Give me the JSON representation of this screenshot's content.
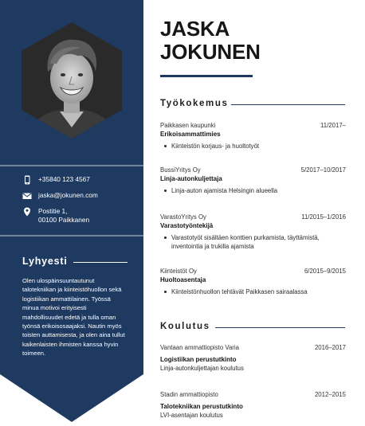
{
  "person": {
    "first_name": "JASKA",
    "last_name": "JOKUNEN"
  },
  "contact": {
    "phone": "+35840 123 4567",
    "email": "jaska@jokunen.com",
    "address_line1": "Postitie 1,",
    "address_line2": "00100 Paikkanen"
  },
  "summary": {
    "heading": "Lyhyesti",
    "text": "Olen ulospäinsuuntautunut talotekniikan ja kiinteistöhuollon sekä logistiikan ammattilainen. Työssä minua motivoi erityisesti mahdollisuudet edetä ja tulla oman työnsä erikoisosaajaksi. Nautin myös toisten auttamisesta, ja olen aina tullut kaikenlaisten ihmisten kanssa hyvin toimeen."
  },
  "experience": {
    "heading": "Työkokemus",
    "items": [
      {
        "company": "Paikkasen kaupunki",
        "dates": "11/2017–",
        "role": "Erikoisammattimies",
        "bullets": [
          "Kiinteistön korjaus- ja huoltotyöt"
        ]
      },
      {
        "company": "BussiYritys Oy",
        "dates": "5/2017–10/2017",
        "role": "Linja-autonkuljettaja",
        "bullets": [
          "Linja-auton ajamista Helsingin alueella"
        ]
      },
      {
        "company": "VarastoYritys Oy",
        "dates": "11/2015–1/2016",
        "role": "Varastotyöntekijä",
        "bullets": [
          "Varastotyöt sisältäen konttien purkamista, täyttämistä, inventointia ja trukilla ajamista"
        ]
      },
      {
        "company": "Kiinteistöt Oy",
        "dates": "6/2015–9/2015",
        "role": "Huoltoasentaja",
        "bullets": [
          "Kiinteistönhuollon tehtävät Paikkasen sairaalassa"
        ]
      }
    ]
  },
  "education": {
    "heading": "Koulutus",
    "items": [
      {
        "school": "Vantaan ammattiopisto Varia",
        "dates": "2016–2017",
        "degree": "Logistiikan perustutkinto",
        "detail": "Linja-autonkuljettajan koulutus"
      },
      {
        "school": "Stadin ammattiopisto",
        "dates": "2012–2015",
        "degree": "Talotekniikan perustutkinto",
        "detail": "LVI-asentajan koulutus"
      }
    ]
  },
  "colors": {
    "sidebar": "#1f3a60",
    "accent": "#1f3a60",
    "text": "#161616"
  },
  "icons": {
    "phone": "phone-icon",
    "email": "envelope-icon",
    "address": "location-pin-icon"
  }
}
